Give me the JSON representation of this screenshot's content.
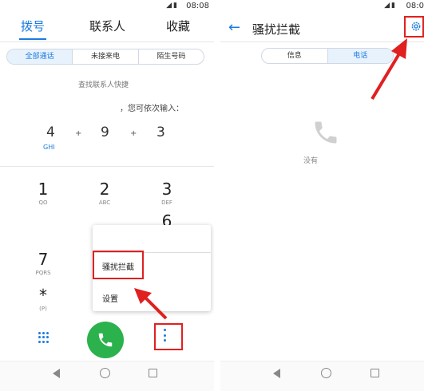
{
  "left_screen": {
    "status": {
      "time": "08:08"
    },
    "tabs": {
      "dial": "拨号",
      "contacts": "联系人",
      "favorites": "收藏"
    },
    "filters": {
      "all": "全部通话",
      "missed": "未接来电",
      "unknown": "陌生号码"
    },
    "hint_line1": "查找联系人快捷",
    "hint_line2": "，您可依次输入：",
    "hint_digits": [
      "4",
      "9",
      "3"
    ],
    "hint_plus": "+",
    "hint_sub": "GHI",
    "keys": [
      {
        "digit": "1",
        "letters": "QO"
      },
      {
        "digit": "2",
        "letters": "ABC"
      },
      {
        "digit": "3",
        "letters": "DEF"
      },
      {
        "digit": "6",
        "letters": ""
      },
      {
        "digit": "7",
        "letters": "PQRS"
      },
      {
        "digit": "*",
        "letters": "(P)"
      }
    ],
    "menu": {
      "harassment": "骚扰拦截",
      "settings": "设置"
    }
  },
  "right_screen": {
    "status": {
      "time": "08:0"
    },
    "title": "骚扰拦截",
    "tabs": {
      "messages": "信息",
      "calls": "电话"
    },
    "empty_text": "没有"
  },
  "colors": {
    "accent": "#1a7be0",
    "call_green": "#2bb24c",
    "annotation_red": "#e02020"
  }
}
